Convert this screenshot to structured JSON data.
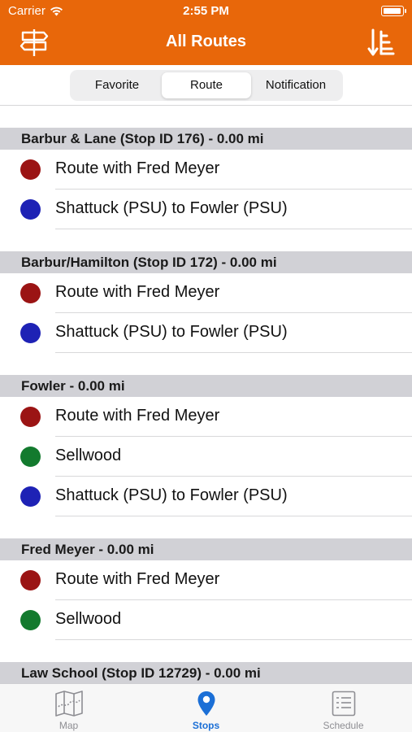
{
  "status_bar": {
    "carrier": "Carrier",
    "time": "2:55 PM",
    "battery_level": 1.0
  },
  "nav": {
    "title": "All Routes",
    "left_icon": "signpost-icon",
    "right_icon": "sort-icon",
    "bar_color": "#e8670a"
  },
  "segments": {
    "items": [
      {
        "label": "Favorite",
        "active": false
      },
      {
        "label": "Route",
        "active": true
      },
      {
        "label": "Notification",
        "active": false
      }
    ]
  },
  "sections": [
    {
      "header": "Barbur & Lane (Stop ID 176) - 0.00 mi",
      "routes": [
        {
          "name": "Route with Fred Meyer",
          "color": "#9b1414"
        },
        {
          "name": "Shattuck (PSU) to Fowler (PSU)",
          "color": "#1e22b5"
        }
      ]
    },
    {
      "header": "Barbur/Hamilton (Stop ID 172) - 0.00 mi",
      "routes": [
        {
          "name": "Route with Fred Meyer",
          "color": "#9b1414"
        },
        {
          "name": "Shattuck (PSU) to Fowler (PSU)",
          "color": "#1e22b5"
        }
      ]
    },
    {
      "header": "Fowler - 0.00 mi",
      "routes": [
        {
          "name": "Route with Fred Meyer",
          "color": "#9b1414"
        },
        {
          "name": "Sellwood",
          "color": "#137a2e"
        },
        {
          "name": "Shattuck (PSU) to Fowler (PSU)",
          "color": "#1e22b5"
        }
      ]
    },
    {
      "header": "Fred Meyer - 0.00 mi",
      "routes": [
        {
          "name": "Route with Fred Meyer",
          "color": "#9b1414"
        },
        {
          "name": "Sellwood",
          "color": "#137a2e"
        }
      ]
    },
    {
      "header": "Law School (Stop ID 12729) - 0.00 mi",
      "routes": []
    }
  ],
  "tabbar": {
    "tabs": [
      {
        "label": "Map",
        "icon": "map-icon",
        "active": false
      },
      {
        "label": "Stops",
        "icon": "location-pin-icon",
        "active": true
      },
      {
        "label": "Schedule",
        "icon": "schedule-list-icon",
        "active": false
      }
    ]
  }
}
